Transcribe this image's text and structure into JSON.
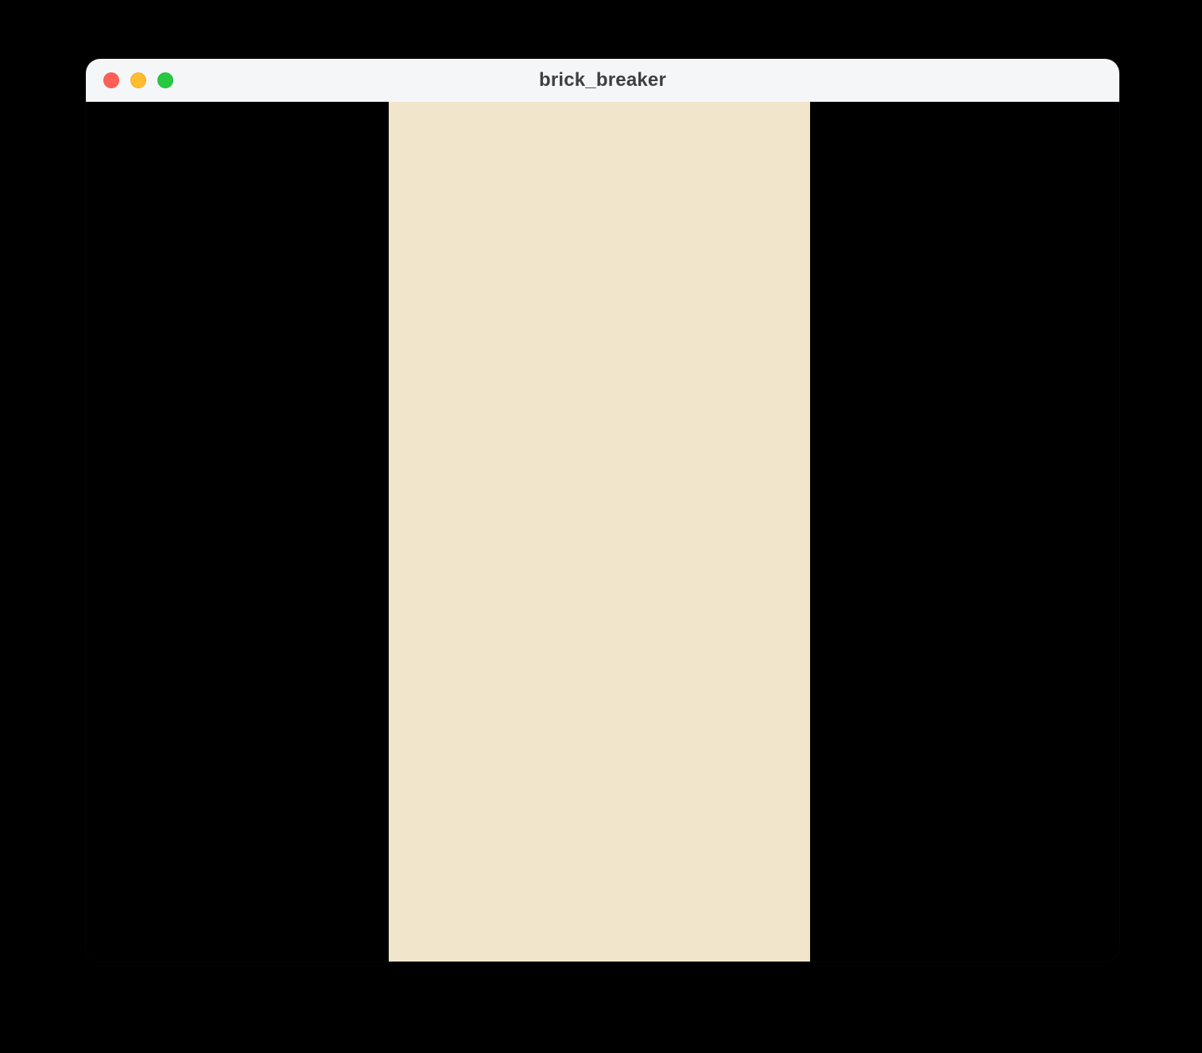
{
  "window": {
    "title": "brick_breaker"
  },
  "colors": {
    "canvas_bg": "#F1E6CC",
    "titlebar_bg": "#F5F6F8",
    "page_bg": "#000000",
    "traffic_close": "#FF5F57",
    "traffic_min": "#FEBC2E",
    "traffic_max": "#28C840"
  }
}
